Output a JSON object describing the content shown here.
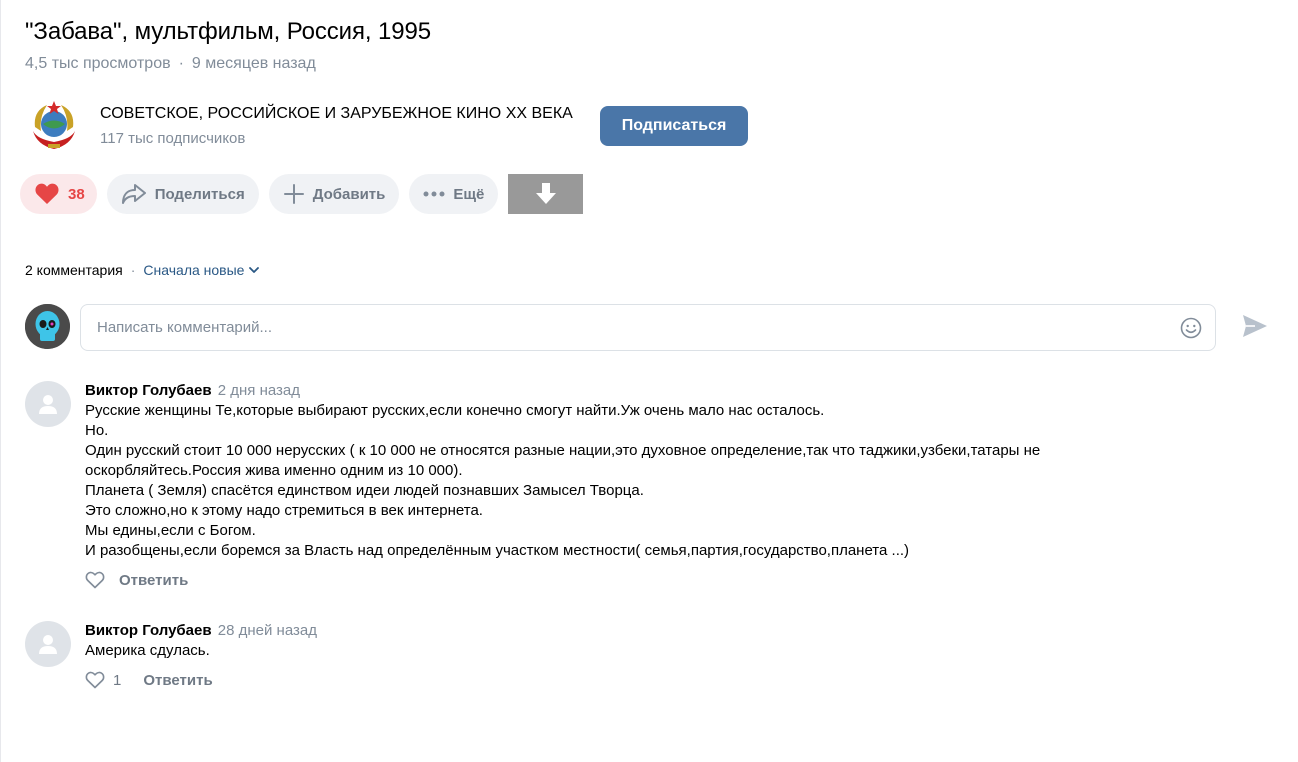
{
  "video": {
    "title": "\"Забава\", мультфильм, Россия, 1995",
    "views": "4,5 тыс просмотров",
    "separator": "·",
    "age": "9 месяцев назад"
  },
  "channel": {
    "name": "СОВЕТСКОЕ, РОССИЙСКОЕ И ЗАРУБЕЖНОЕ КИНО XX ВЕКА",
    "subscribers": "117 тыс подписчиков",
    "subscribe_label": "Подписаться",
    "logo_icon": "ussr-emblem-icon"
  },
  "actions": {
    "likes_count": "38",
    "share_label": "Поделиться",
    "add_label": "Добавить",
    "more_label": "Ещё",
    "download_icon": "download-arrow-icon"
  },
  "comments": {
    "count_label": "2 комментария",
    "separator": "·",
    "sort_label": "Сначала новые",
    "input_placeholder": "Написать комментарий...",
    "items": [
      {
        "author": "Виктор Голубаев",
        "date": "2 дня назад",
        "lines": [
          "Русские женщины Те,которые выбирают русских,если конечно смогут найти.Уж очень мало нас осталось.",
          "Но.",
          "Один русский стоит 10 000 нерусских ( к 10 000 не относятся разные нации,это духовное определение,так что таджики,узбеки,татары не",
          "оскорбляйтесь.Россия жива именно одним из 10 000).",
          "Планета ( Земля) спасётся единством идеи людей познавших Замысел Творца.",
          "Это сложно,но к этому надо стремиться в век интернета.",
          "Мы едины,если с Богом.",
          "И разобщены,если боремся за Власть над определённым участком местности( семья,партия,государство,планета ...)"
        ],
        "likes": "",
        "reply_label": "Ответить"
      },
      {
        "author": "Виктор Голубаев",
        "date": "28 дней назад",
        "lines": [
          "Америка сдулась."
        ],
        "likes": "1",
        "reply_label": "Ответить"
      }
    ]
  },
  "colors": {
    "accent": "#4a76a8",
    "link": "#2a5885",
    "muted": "#818c99",
    "like_red": "#e64646"
  }
}
